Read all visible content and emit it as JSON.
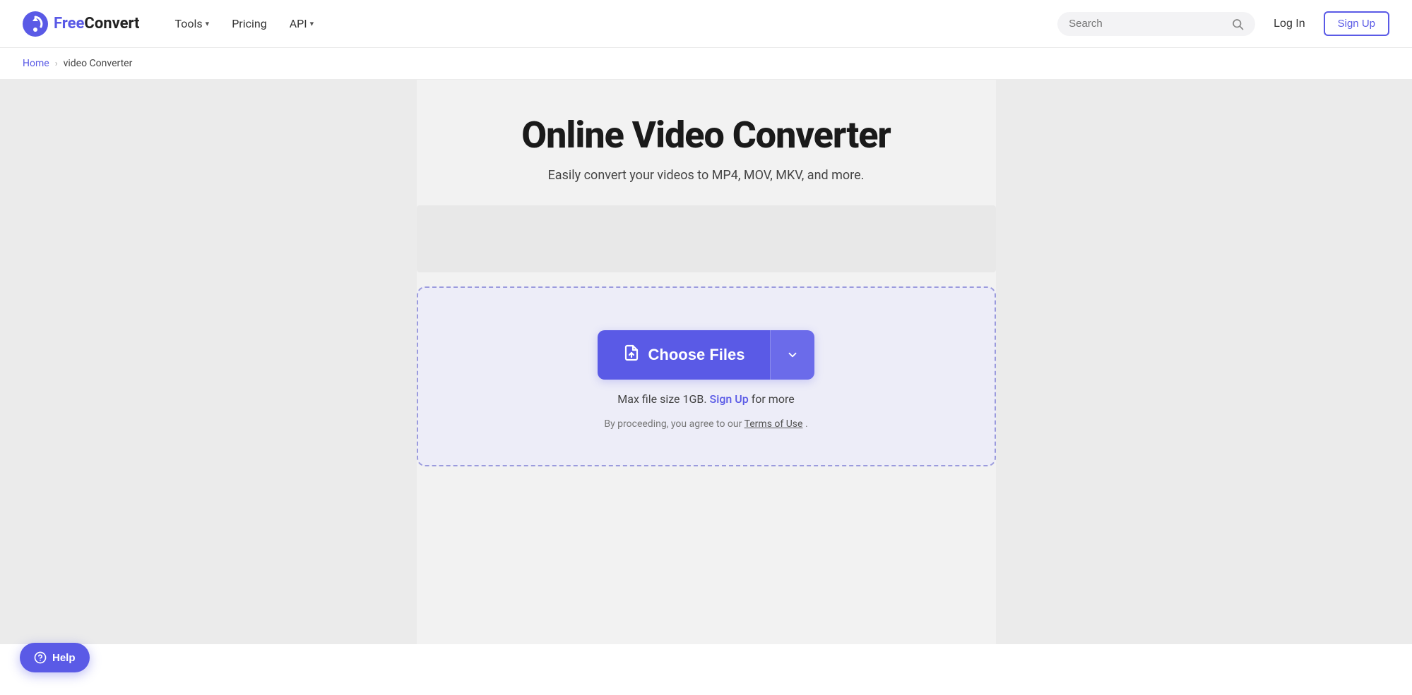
{
  "brand": {
    "name_free": "Free",
    "name_convert": "Convert",
    "logo_alt": "FreeConvert logo"
  },
  "nav": {
    "tools_label": "Tools",
    "pricing_label": "Pricing",
    "api_label": "API",
    "login_label": "Log In",
    "signup_label": "Sign Up",
    "search_placeholder": "Search"
  },
  "breadcrumb": {
    "home_label": "Home",
    "separator": "›",
    "current_label": "video Converter"
  },
  "hero": {
    "title": "Online Video Converter",
    "subtitle": "Easily convert your videos to MP4, MOV, MKV, and more."
  },
  "dropzone": {
    "choose_files_label": "Choose Files",
    "file_size_text": "Max file size 1GB.",
    "signup_link_label": "Sign Up",
    "file_size_suffix": " for more",
    "terms_prefix": "By proceeding, you agree to our ",
    "terms_link_label": "Terms of Use",
    "terms_suffix": "."
  },
  "help": {
    "label": "Help"
  }
}
